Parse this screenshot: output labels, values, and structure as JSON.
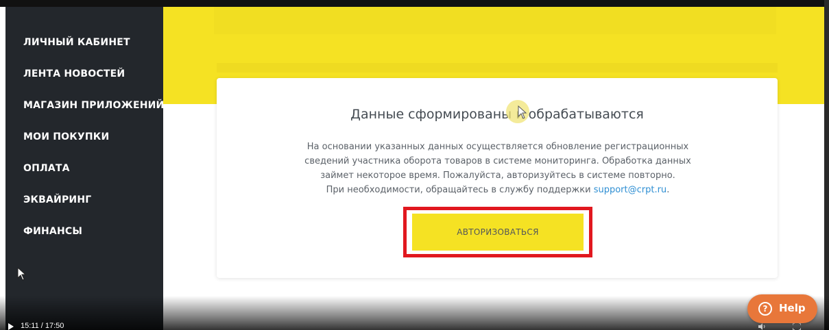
{
  "sidebar": {
    "items": [
      {
        "label": "ЛИЧНЫЙ КАБИНЕТ"
      },
      {
        "label": "ЛЕНТА НОВОСТЕЙ"
      },
      {
        "label": "МАГАЗИН ПРИЛОЖЕНИЙ"
      },
      {
        "label": "МОИ ПОКУПКИ"
      },
      {
        "label": "ОПЛАТА"
      },
      {
        "label": "ЭКВАЙРИНГ"
      },
      {
        "label": "ФИНАНСЫ"
      }
    ]
  },
  "card": {
    "title": "Данные сформированы и обрабатываются",
    "text_lines": [
      "На основании указанных данных осуществляется обновление регистрационных",
      "сведений участника оборота товаров в системе мониторинга. Обработка данных",
      "займет некоторое время. Пожалуйста, авторизуйтесь в системе повторно."
    ],
    "support_prefix": "При необходимости, обращайтесь в службу поддержки ",
    "support_email": "support@crpt.ru",
    "support_suffix": ".",
    "button_label": "АВТОРИЗОВАТЬСЯ"
  },
  "help": {
    "label": "Help",
    "icon_glyph": "?"
  },
  "video": {
    "time": "15:11 / 17:50"
  },
  "colors": {
    "accent_yellow": "#f5e223",
    "sidebar_bg": "#23272c",
    "highlight_red": "#e1181f",
    "help_orange": "#e8773a",
    "link_blue": "#2f8fd3"
  },
  "icons": [
    "play-icon",
    "volume-icon",
    "fullscreen-icon",
    "help-icon",
    "mouse-cursor-icon"
  ]
}
